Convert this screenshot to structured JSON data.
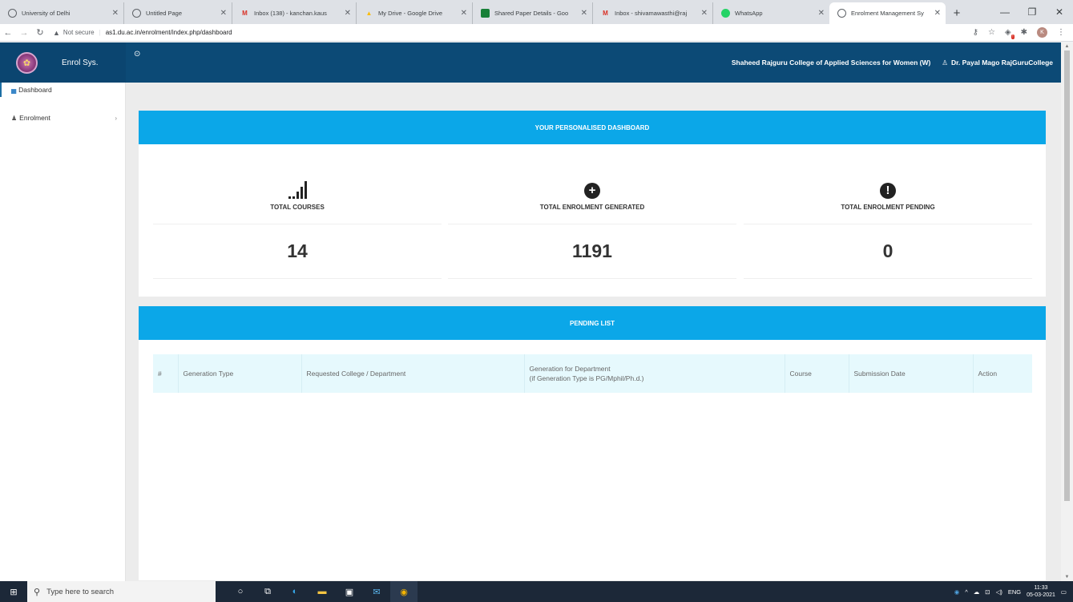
{
  "browser": {
    "tabs": [
      {
        "title": "University of Delhi",
        "active": false,
        "favicon": "globe-icon",
        "color": "#5f6368"
      },
      {
        "title": "Untitled Page",
        "active": false,
        "favicon": "globe-icon",
        "color": "#5f6368"
      },
      {
        "title": "Inbox (138) - kanchan.kaus",
        "active": false,
        "favicon": "gmail-icon",
        "color": "#d93025"
      },
      {
        "title": "My Drive - Google Drive",
        "active": false,
        "favicon": "drive-icon",
        "color": "#fbbc04"
      },
      {
        "title": "Shared Paper Details - Goo",
        "active": false,
        "favicon": "sheets-icon",
        "color": "#188038"
      },
      {
        "title": "Inbox - shivamawasthi@raj",
        "active": false,
        "favicon": "gmail-icon",
        "color": "#d93025"
      },
      {
        "title": "WhatsApp",
        "active": false,
        "favicon": "whatsapp-icon",
        "color": "#25d366"
      },
      {
        "title": "Enrolment Management Sy",
        "active": true,
        "favicon": "globe-icon",
        "color": "#5f6368"
      }
    ],
    "address": {
      "security": "Not secure",
      "url": "as1.du.ac.in/enrolment/index.php/dashboard"
    },
    "profile_initial": "K"
  },
  "app": {
    "name": "Enrol Sys.",
    "college": "Shaheed Rajguru College of Applied Sciences for Women (W)",
    "user": "Dr. Payal Mago RajGuruCollege"
  },
  "sidebar": {
    "items": [
      {
        "label": "Dashboard"
      },
      {
        "label": "Enrolment"
      }
    ]
  },
  "dashboard": {
    "heading": "YOUR PERSONALISED DASHBOARD",
    "stats": [
      {
        "label": "TOTAL COURSES",
        "value": "14"
      },
      {
        "label": "TOTAL ENROLMENT GENERATED",
        "value": "1191"
      },
      {
        "label": "TOTAL ENROLMENT PENDING",
        "value": "0"
      }
    ]
  },
  "pending": {
    "heading": "PENDING LIST",
    "columns": [
      "#",
      "Generation Type",
      "Requested College / Department",
      "Generation for Department",
      "(if Generation Type is PG/Mphil/Ph.d.)",
      "Course",
      "Submission Date",
      "Action"
    ]
  },
  "taskbar": {
    "search_placeholder": "Type here to search",
    "lang": "ENG",
    "time": "11:33",
    "date": "05-03-2021"
  },
  "colors": {
    "header": "#0c4a76",
    "accent": "#0ba7e8",
    "table_bg": "#e6f9fd"
  }
}
